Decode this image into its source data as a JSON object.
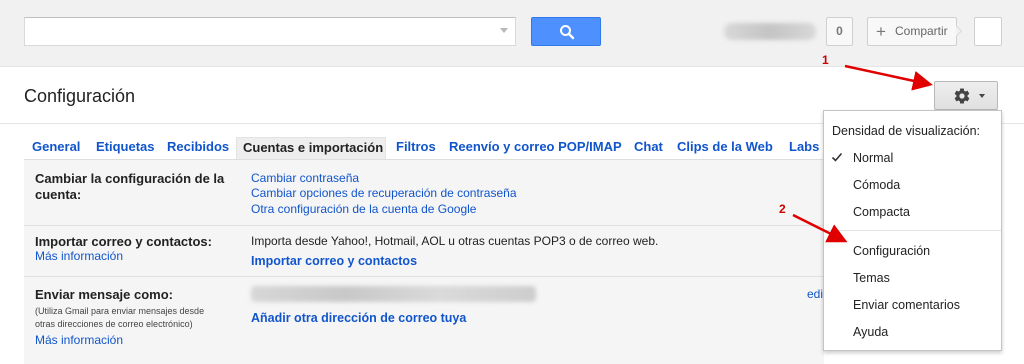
{
  "topbar": {
    "search_value": "",
    "notification_count": "0",
    "share_label": "Compartir"
  },
  "header": {
    "title": "Configuración"
  },
  "tabs": [
    {
      "label": "General"
    },
    {
      "label": "Etiquetas"
    },
    {
      "label": "Recibidos"
    },
    {
      "label": "Cuentas e importación",
      "active": true
    },
    {
      "label": "Filtros"
    },
    {
      "label": "Reenvío y correo POP/IMAP"
    },
    {
      "label": "Chat"
    },
    {
      "label": "Clips de la Web"
    },
    {
      "label": "Labs"
    }
  ],
  "rows": {
    "account": {
      "title_line1": "Cambiar la configuración de la",
      "title_line2": "cuenta:",
      "links": [
        "Cambiar contraseña",
        "Cambiar opciones de recuperación de contraseña",
        "Otra configuración de la cuenta de Google"
      ]
    },
    "import": {
      "title": "Importar correo y contactos:",
      "more_info": "Más información",
      "description": "Importa desde Yahoo!, Hotmail, AOL u otras cuentas POP3 o de correo web.",
      "action": "Importar correo y contactos"
    },
    "send_as": {
      "title": "Enviar mensaje como:",
      "note_line1": "(Utiliza Gmail para enviar mensajes desde",
      "note_line2": "otras direcciones de correo electrónico)",
      "more_info": "Más información",
      "action": "Añadir otra dirección de correo tuya",
      "edit_link": "edi"
    }
  },
  "dropdown": {
    "heading": "Densidad de visualización:",
    "density_options": [
      {
        "label": "Normal",
        "checked": true
      },
      {
        "label": "Cómoda"
      },
      {
        "label": "Compacta"
      }
    ],
    "items": [
      "Configuración",
      "Temas",
      "Enviar comentarios",
      "Ayuda"
    ]
  },
  "annotations": {
    "step1": "1",
    "step2": "2",
    "arrow_color": "#e00000"
  },
  "colors": {
    "link": "#1155cc",
    "search_button": "#4d90fe",
    "topbar_bg": "#f1f1f1"
  },
  "icons": [
    "search-icon",
    "gear-icon",
    "check-icon",
    "plus-icon",
    "chevron-down-icon"
  ]
}
